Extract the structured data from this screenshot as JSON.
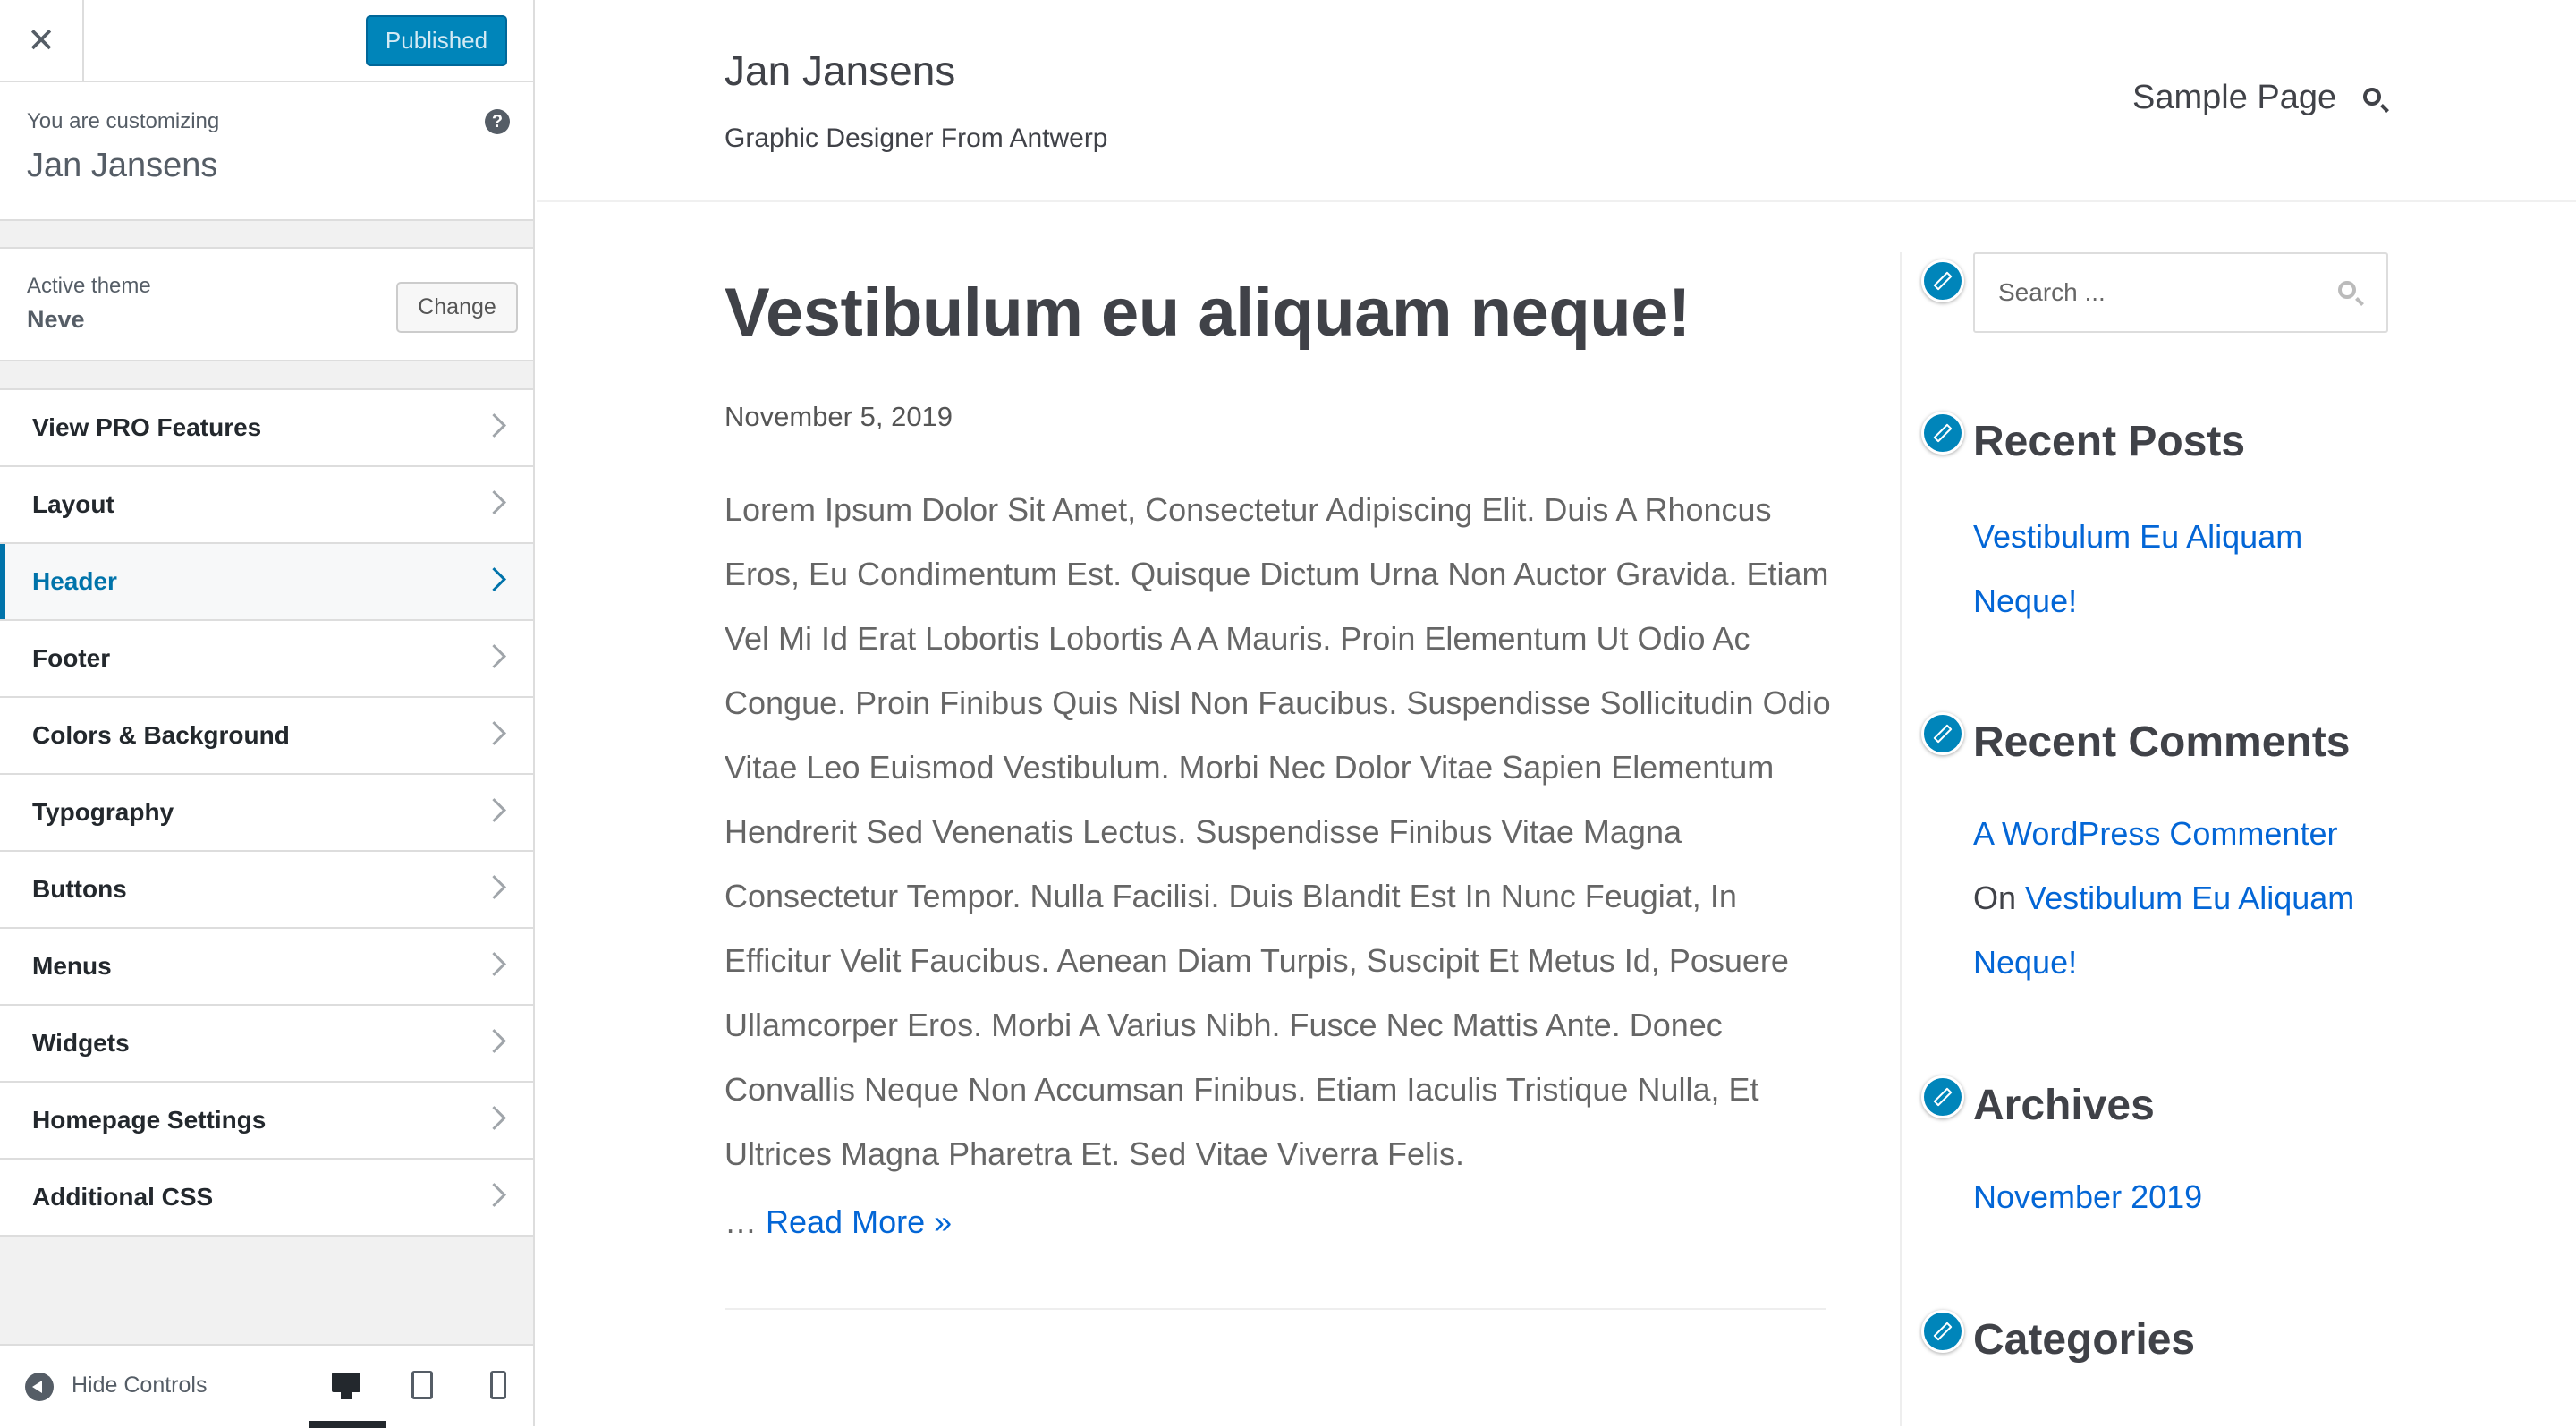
{
  "customizer": {
    "close_icon": "close-icon",
    "publish_label": "Published",
    "customizing_label": "You are customizing",
    "site_name": "Jan Jansens",
    "help_icon": "?",
    "active_theme_label": "Active theme",
    "theme_name": "Neve",
    "change_label": "Change",
    "menu": [
      {
        "label": "View PRO Features"
      },
      {
        "label": "Layout"
      },
      {
        "label": "Header",
        "active": true
      },
      {
        "label": "Footer"
      },
      {
        "label": "Colors & Background"
      },
      {
        "label": "Typography"
      },
      {
        "label": "Buttons"
      },
      {
        "label": "Menus"
      },
      {
        "label": "Widgets"
      },
      {
        "label": "Homepage Settings"
      },
      {
        "label": "Additional CSS"
      }
    ],
    "hide_controls_label": "Hide Controls",
    "device_icons": [
      "desktop-icon",
      "tablet-icon",
      "mobile-icon"
    ],
    "active_device": "desktop",
    "accent_color": "#0073aa",
    "publish_color": "#0085ba"
  },
  "site": {
    "title": "Jan Jansens",
    "tagline": "Graphic Designer From Antwerp",
    "nav": {
      "sample_page": "Sample Page",
      "search_icon": "search-icon"
    }
  },
  "post": {
    "title": "Vestibulum eu aliquam neque!",
    "date": "November 5, 2019",
    "excerpt": "Lorem Ipsum Dolor Sit Amet, Consectetur Adipiscing Elit. Duis A Rhoncus Eros, Eu Condimentum Est. Quisque Dictum Urna Non Auctor Gravida. Etiam Vel Mi Id Erat Lobortis Lobortis A A Mauris. Proin Elementum Ut Odio Ac Congue. Proin Finibus Quis Nisl Non Faucibus. Suspendisse Sollicitudin Odio Vitae Leo Euismod Vestibulum. Morbi Nec Dolor Vitae Sapien Elementum Hendrerit Sed Venenatis Lectus. Suspendisse Finibus Vitae Magna Consectetur Tempor. Nulla Facilisi. Duis Blandit Est In Nunc Feugiat, In Efficitur Velit Faucibus. Aenean Diam Turpis, Suscipit Et Metus Id, Posuere Ullamcorper Eros. Morbi A Varius Nibh. Fusce Nec Mattis Ante. Donec Convallis Neque Non Accumsan Finibus. Etiam Iaculis Tristique Nulla, Et Ultrices Magna Pharetra Et. Sed Vitae Viverra Felis.",
    "ellipsis": "…",
    "read_more": "Read More »"
  },
  "widgets": {
    "search_placeholder": "Search ...",
    "recent_posts_title": "Recent Posts",
    "recent_posts": [
      "Vestibulum Eu Aliquam",
      "Neque!"
    ],
    "recent_comments_title": "Recent Comments",
    "comment_author": "A WordPress Commenter",
    "comment_on": "On",
    "comment_post_line1": "Vestibulum Eu Aliquam",
    "comment_post_line2": "Neque!",
    "archives_title": "Archives",
    "archive_item": "November 2019",
    "categories_title": "Categories",
    "edit_icon": "pencil-icon",
    "link_color": "#0366d6"
  }
}
